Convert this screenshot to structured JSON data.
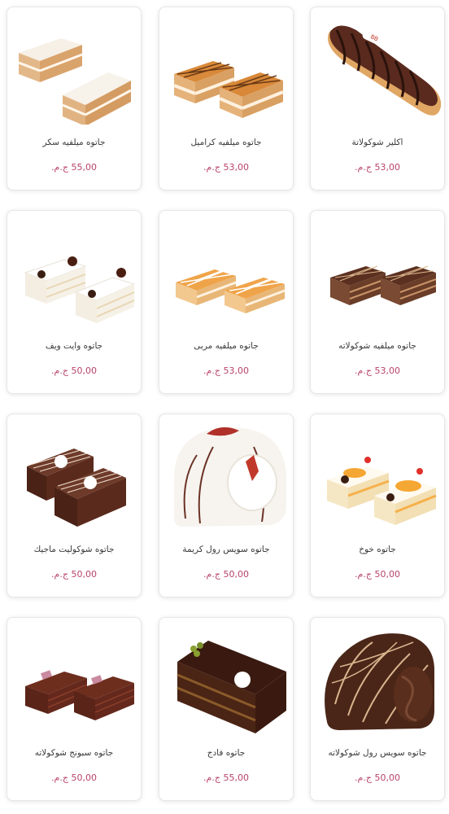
{
  "colors": {
    "price": "#b8436b",
    "name": "#3a3a3a",
    "card_border": "#e6e6e6"
  },
  "products": [
    {
      "name": "جاتوه ميلفيه سكر",
      "price": "55,00 ج.م.",
      "image": "mille-feuille-sugar-image"
    },
    {
      "name": "جاتوه ميلفيه كراميل",
      "price": "53,00 ج.م.",
      "image": "mille-feuille-caramel-image"
    },
    {
      "name": "اكلير شوكولاتة",
      "price": "53,00 ج.م.",
      "image": "chocolate-eclair-image"
    },
    {
      "name": "جاتوه وايت ويف",
      "price": "50,00 ج.م.",
      "image": "white-wave-gateau-image"
    },
    {
      "name": "جاتوه ميلفيه مربى",
      "price": "53,00 ج.م.",
      "image": "mille-feuille-jam-image"
    },
    {
      "name": "جاتوه ميلفيه شوكولاته",
      "price": "53,00 ج.م.",
      "image": "mille-feuille-chocolate-image"
    },
    {
      "name": "جاتوه شوكوليت ماجيك",
      "price": "50,00 ج.م.",
      "image": "chocolate-magic-gateau-image"
    },
    {
      "name": "جاتوه سويس رول كريمة",
      "price": "50,00 ج.م.",
      "image": "swiss-roll-cream-image"
    },
    {
      "name": "جاتوه خوخ",
      "price": "50,00 ج.م.",
      "image": "peach-gateau-image"
    },
    {
      "name": "جاتوه سبونج شوكولاته",
      "price": "50,00 ج.م.",
      "image": "chocolate-sponge-gateau-image"
    },
    {
      "name": "جاتوه فادج",
      "price": "55,00 ج.م.",
      "image": "fudge-gateau-image"
    },
    {
      "name": "جاتوه سويس رول شوكولاته",
      "price": "50,00 ج.م.",
      "image": "swiss-roll-chocolate-image"
    }
  ]
}
